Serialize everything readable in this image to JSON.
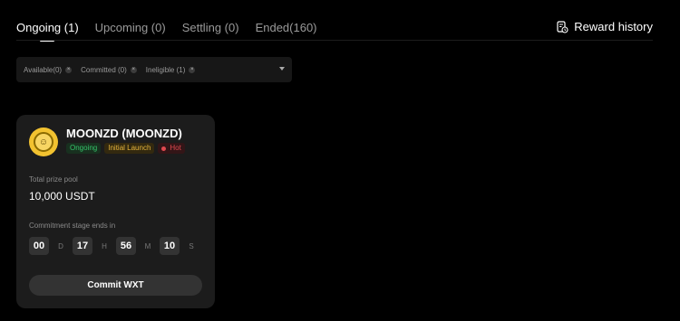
{
  "tabs": [
    {
      "label": "Ongoing (1)"
    },
    {
      "label": "Upcoming (0)"
    },
    {
      "label": "Settling (0)"
    },
    {
      "label": "Ended(160)"
    }
  ],
  "reward_history_label": "Reward history",
  "filters": [
    {
      "label": "Available(0)"
    },
    {
      "label": "Committed (0)"
    },
    {
      "label": "Ineligible (1)"
    }
  ],
  "card": {
    "title": "MOONZD (MOONZD)",
    "badges": {
      "ongoing": "Ongoing",
      "initial": "Initial Launch",
      "hot": "Hot"
    },
    "prize_label": "Total prize pool",
    "prize_value": "10,000 USDT",
    "stage_label": "Commitment stage ends in",
    "countdown": {
      "days": "00",
      "d_unit": "D",
      "hours": "17",
      "h_unit": "H",
      "minutes": "56",
      "m_unit": "M",
      "seconds": "10",
      "s_unit": "S"
    },
    "commit_label": "Commit WXT"
  },
  "colors": {
    "accent_green": "#35c46a",
    "accent_yellow": "#e6b53c",
    "accent_red": "#e0494f"
  }
}
